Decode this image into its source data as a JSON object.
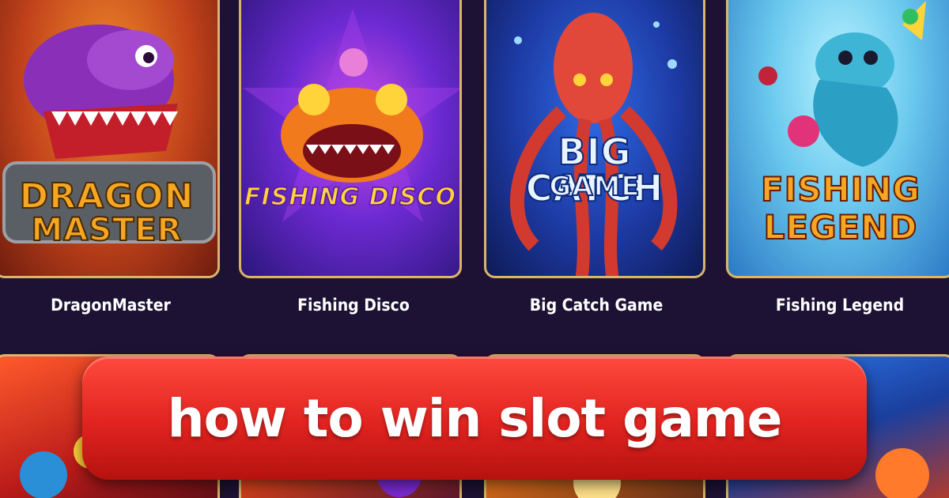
{
  "games": [
    {
      "logo_line1": "DRAGON",
      "logo_line2": "MASTER",
      "name": "DragonMaster",
      "accent": "#f5a623"
    },
    {
      "logo_line1": "FISHING DISCO",
      "logo_line2": "",
      "name": "Fishing Disco",
      "accent": "#ffd43b"
    },
    {
      "logo_line1": "BIG CATCH",
      "logo_line2": "GAME",
      "name": "Big Catch Game",
      "accent": "#e8f4ff"
    },
    {
      "logo_line1": "FISHING",
      "logo_line2": "LEGEND",
      "name": "Fishing Legend",
      "accent": "#f5a623"
    }
  ],
  "banner": {
    "text": "how to win slot game"
  },
  "colors": {
    "background": "#1d1233",
    "card_border": "#d9b46a",
    "banner": "#e0231f"
  }
}
